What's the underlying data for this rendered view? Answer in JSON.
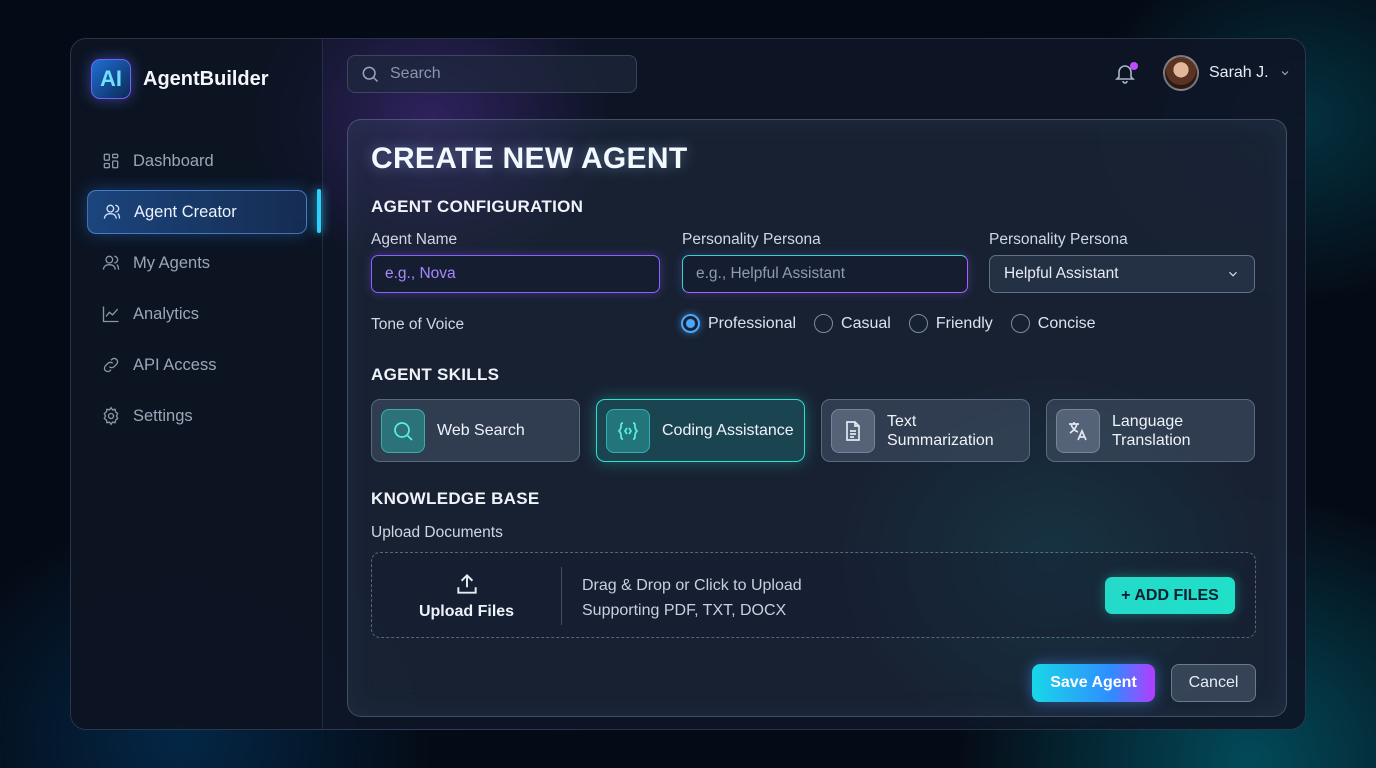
{
  "brand": {
    "logo_text": "AI",
    "name": "AgentBuilder"
  },
  "sidebar": {
    "items": [
      {
        "label": "Dashboard",
        "icon": "dashboard-icon",
        "active": false
      },
      {
        "label": "Agent Creator",
        "icon": "user-icon",
        "active": true
      },
      {
        "label": "My Agents",
        "icon": "users-icon",
        "active": false
      },
      {
        "label": "Analytics",
        "icon": "chart-line-icon",
        "active": false
      },
      {
        "label": "API Access",
        "icon": "link-icon",
        "active": false
      },
      {
        "label": "Settings",
        "icon": "gear-icon",
        "active": false
      }
    ]
  },
  "topbar": {
    "search_placeholder": "Search",
    "user_name": "Sarah J.",
    "has_notification": true
  },
  "form": {
    "title": "CREATE NEW AGENT",
    "config": {
      "section_title": "AGENT CONFIGURATION",
      "agent_name_label": "Agent Name",
      "agent_name_placeholder": "e.g., Nova",
      "persona_label": "Personality Persona",
      "persona_placeholder": "e.g., Helpful Assistant",
      "persona_select_label": "Personality Persona",
      "persona_select_value": "Helpful Assistant",
      "tone_label": "Tone of Voice",
      "tone_options": [
        {
          "label": "Professional",
          "selected": true
        },
        {
          "label": "Casual",
          "selected": false
        },
        {
          "label": "Friendly",
          "selected": false
        },
        {
          "label": "Concise",
          "selected": false
        }
      ]
    },
    "skills": {
      "section_title": "AGENT SKILLS",
      "items": [
        {
          "label": "Web Search",
          "icon": "search-icon",
          "selected": false
        },
        {
          "label": "Coding Assistance",
          "icon": "code-icon",
          "selected": true
        },
        {
          "label": "Text Summarization",
          "icon": "document-icon",
          "selected": false
        },
        {
          "label": "Language Translation",
          "icon": "translate-icon",
          "selected": false
        }
      ]
    },
    "knowledge": {
      "section_title": "KNOWLEDGE BASE",
      "upload_label": "Upload Documents",
      "upload_button_label": "Upload Files",
      "drop_text": "Drag & Drop or Click to Upload",
      "supported_text": "Supporting PDF, TXT, DOCX",
      "add_files_label": "+ ADD FILES"
    },
    "actions": {
      "save_label": "Save Agent",
      "cancel_label": "Cancel"
    }
  },
  "colors": {
    "accent_teal": "#2fe0d0",
    "accent_blue": "#4aa8ff",
    "accent_purple": "#b43cff"
  }
}
